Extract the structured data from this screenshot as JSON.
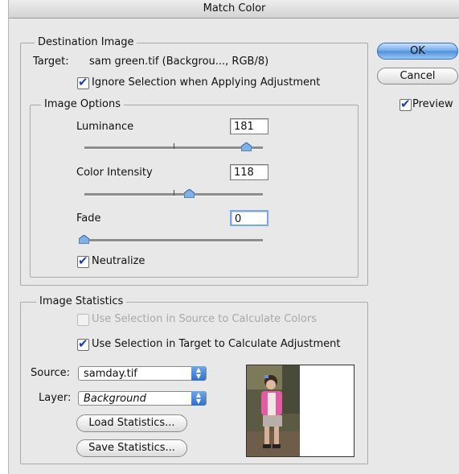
{
  "dialog_title": "Match Color",
  "destination": {
    "group_label": "Destination Image",
    "target_label": "Target:",
    "target_value": "sam green.tif (Backgrou..., RGB/8)",
    "ignore_selection_label": "Ignore Selection when Applying Adjustment",
    "ignore_selection_checked": true
  },
  "image_options": {
    "group_label": "Image Options",
    "luminance_label": "Luminance",
    "luminance_value": "181",
    "color_intensity_label": "Color Intensity",
    "color_intensity_value": "118",
    "fade_label": "Fade",
    "fade_value": "0",
    "neutralize_label": "Neutralize",
    "neutralize_checked": true
  },
  "image_statistics": {
    "group_label": "Image Statistics",
    "use_source_selection_label": "Use Selection in Source to Calculate Colors",
    "use_source_selection_checked": false,
    "use_source_selection_enabled": false,
    "use_target_selection_label": "Use Selection in Target to Calculate Adjustment",
    "use_target_selection_checked": true,
    "source_label": "Source:",
    "source_value": "samday.tif",
    "layer_label": "Layer:",
    "layer_value": "Background",
    "load_button": "Load Statistics...",
    "save_button": "Save Statistics..."
  },
  "buttons": {
    "ok": "OK",
    "cancel": "Cancel"
  },
  "preview": {
    "label": "Preview",
    "checked": true
  },
  "colors": {
    "accent": "#4c8fdc",
    "check": "#1f3fb0",
    "dialog_bg": "#e8e8e8"
  }
}
